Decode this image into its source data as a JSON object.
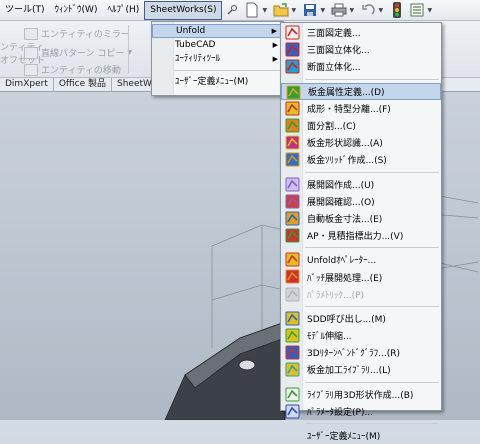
{
  "menubar": {
    "items": [
      "ツール(T)",
      "ｳｨﾝﾄﾞｳ(W)",
      "ﾍﾙﾌﾟ(H)",
      "SheetWorks(S)"
    ]
  },
  "ribbon": {
    "row1": "エンティティのミラー",
    "row2": "直線パターン コピー",
    "row3": "エンティティの移動",
    "left1": "ンティティ",
    "left2": "オフセット"
  },
  "tabs": [
    "DimXpert",
    "Office 製品",
    "SheetWorks"
  ],
  "menu1": {
    "items": [
      {
        "label": "Unfold",
        "submenu": true
      },
      {
        "label": "TubeCAD",
        "submenu": true
      },
      {
        "label": "ﾕｰﾃｨﾘﾃｨﾂｰﾙ",
        "submenu": true
      },
      {
        "label": "ﾕｰｻﾞｰ定義ﾒﾆｭｰ(M)",
        "submenu": false
      }
    ]
  },
  "menu2": {
    "groups": [
      [
        {
          "label": "三面図定義...",
          "icon": "three-view-define-icon"
        },
        {
          "label": "三面図立体化...",
          "icon": "three-view-solidify-icon"
        },
        {
          "label": "断面立体化...",
          "icon": "section-solidify-icon"
        }
      ],
      [
        {
          "label": "板金属性定義...(D)",
          "icon": "sheetmetal-attribute-icon"
        },
        {
          "label": "成形・特型分離...(F)",
          "icon": "form-separate-icon"
        },
        {
          "label": "面分割...(C)",
          "icon": "face-split-icon"
        },
        {
          "label": "板金形状認識...(A)",
          "icon": "sheetmetal-recognize-icon"
        },
        {
          "label": "板金ｿﾘｯﾄﾞ作成...(S)",
          "icon": "sheetmetal-solid-icon"
        }
      ],
      [
        {
          "label": "展開図作成...(U)",
          "icon": "unfold-create-icon"
        },
        {
          "label": "展開図確認...(O)",
          "icon": "unfold-check-icon"
        },
        {
          "label": "自動板金寸法...(E)",
          "icon": "auto-dimension-icon"
        },
        {
          "label": "AP・見積指標出力...(V)",
          "icon": "estimate-output-icon"
        }
      ],
      [
        {
          "label": "Unfoldｵﾍﾟﾚｰﾀｰ...",
          "icon": "unfold-operator-icon"
        },
        {
          "label": "ﾊﾞｯﾁ展開処理...(E)",
          "icon": "batch-unfold-icon"
        },
        {
          "label": "ﾊﾟﾗﾒﾄﾘｯｸ...(P)",
          "icon": "parametric-icon"
        }
      ],
      [
        {
          "label": "SDD呼び出し...(M)",
          "icon": "sdd-call-icon"
        },
        {
          "label": "ﾓﾃﾞﾙ伸縮...",
          "icon": "model-stretch-icon"
        },
        {
          "label": "3Dﾘﾀｰﾝﾍﾞﾝﾄﾞｸﾞﾗﾌ...(R)",
          "icon": "return-bend-graph-icon"
        },
        {
          "label": "板金加工ﾗｲﾌﾞﾗﾘ...(L)",
          "icon": "sheetmetal-library-icon"
        }
      ],
      [
        {
          "label": "ﾗｲﾌﾞﾗﾘ用3D形状作成...(B)",
          "icon": "library-3d-shape-icon"
        },
        {
          "label": "ﾊﾟﾗﾒｰﾀ設定(P)...",
          "icon": "parameter-settings-icon"
        }
      ],
      [
        {
          "label": "ﾕｰｻﾞｰ定義ﾒﾆｭｰ(M)",
          "icon": ""
        }
      ]
    ]
  },
  "colors": {
    "menu_bg": "#f5f6f7",
    "highlight": "#c4d6ec",
    "disabled_text": "#a3a8ae",
    "model_dark": "#3c4148"
  }
}
